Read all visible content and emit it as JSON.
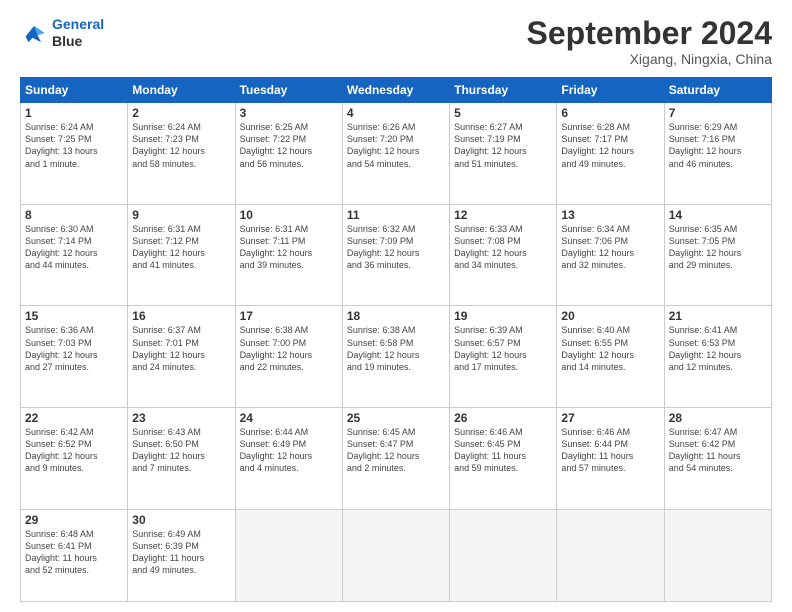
{
  "header": {
    "logo_line1": "General",
    "logo_line2": "Blue",
    "month": "September 2024",
    "location": "Xigang, Ningxia, China"
  },
  "weekdays": [
    "Sunday",
    "Monday",
    "Tuesday",
    "Wednesday",
    "Thursday",
    "Friday",
    "Saturday"
  ],
  "weeks": [
    [
      {
        "day": "1",
        "info": "Sunrise: 6:24 AM\nSunset: 7:25 PM\nDaylight: 13 hours\nand 1 minute."
      },
      {
        "day": "2",
        "info": "Sunrise: 6:24 AM\nSunset: 7:23 PM\nDaylight: 12 hours\nand 58 minutes."
      },
      {
        "day": "3",
        "info": "Sunrise: 6:25 AM\nSunset: 7:22 PM\nDaylight: 12 hours\nand 56 minutes."
      },
      {
        "day": "4",
        "info": "Sunrise: 6:26 AM\nSunset: 7:20 PM\nDaylight: 12 hours\nand 54 minutes."
      },
      {
        "day": "5",
        "info": "Sunrise: 6:27 AM\nSunset: 7:19 PM\nDaylight: 12 hours\nand 51 minutes."
      },
      {
        "day": "6",
        "info": "Sunrise: 6:28 AM\nSunset: 7:17 PM\nDaylight: 12 hours\nand 49 minutes."
      },
      {
        "day": "7",
        "info": "Sunrise: 6:29 AM\nSunset: 7:16 PM\nDaylight: 12 hours\nand 46 minutes."
      }
    ],
    [
      {
        "day": "8",
        "info": "Sunrise: 6:30 AM\nSunset: 7:14 PM\nDaylight: 12 hours\nand 44 minutes."
      },
      {
        "day": "9",
        "info": "Sunrise: 6:31 AM\nSunset: 7:12 PM\nDaylight: 12 hours\nand 41 minutes."
      },
      {
        "day": "10",
        "info": "Sunrise: 6:31 AM\nSunset: 7:11 PM\nDaylight: 12 hours\nand 39 minutes."
      },
      {
        "day": "11",
        "info": "Sunrise: 6:32 AM\nSunset: 7:09 PM\nDaylight: 12 hours\nand 36 minutes."
      },
      {
        "day": "12",
        "info": "Sunrise: 6:33 AM\nSunset: 7:08 PM\nDaylight: 12 hours\nand 34 minutes."
      },
      {
        "day": "13",
        "info": "Sunrise: 6:34 AM\nSunset: 7:06 PM\nDaylight: 12 hours\nand 32 minutes."
      },
      {
        "day": "14",
        "info": "Sunrise: 6:35 AM\nSunset: 7:05 PM\nDaylight: 12 hours\nand 29 minutes."
      }
    ],
    [
      {
        "day": "15",
        "info": "Sunrise: 6:36 AM\nSunset: 7:03 PM\nDaylight: 12 hours\nand 27 minutes."
      },
      {
        "day": "16",
        "info": "Sunrise: 6:37 AM\nSunset: 7:01 PM\nDaylight: 12 hours\nand 24 minutes."
      },
      {
        "day": "17",
        "info": "Sunrise: 6:38 AM\nSunset: 7:00 PM\nDaylight: 12 hours\nand 22 minutes."
      },
      {
        "day": "18",
        "info": "Sunrise: 6:38 AM\nSunset: 6:58 PM\nDaylight: 12 hours\nand 19 minutes."
      },
      {
        "day": "19",
        "info": "Sunrise: 6:39 AM\nSunset: 6:57 PM\nDaylight: 12 hours\nand 17 minutes."
      },
      {
        "day": "20",
        "info": "Sunrise: 6:40 AM\nSunset: 6:55 PM\nDaylight: 12 hours\nand 14 minutes."
      },
      {
        "day": "21",
        "info": "Sunrise: 6:41 AM\nSunset: 6:53 PM\nDaylight: 12 hours\nand 12 minutes."
      }
    ],
    [
      {
        "day": "22",
        "info": "Sunrise: 6:42 AM\nSunset: 6:52 PM\nDaylight: 12 hours\nand 9 minutes."
      },
      {
        "day": "23",
        "info": "Sunrise: 6:43 AM\nSunset: 6:50 PM\nDaylight: 12 hours\nand 7 minutes."
      },
      {
        "day": "24",
        "info": "Sunrise: 6:44 AM\nSunset: 6:49 PM\nDaylight: 12 hours\nand 4 minutes."
      },
      {
        "day": "25",
        "info": "Sunrise: 6:45 AM\nSunset: 6:47 PM\nDaylight: 12 hours\nand 2 minutes."
      },
      {
        "day": "26",
        "info": "Sunrise: 6:46 AM\nSunset: 6:45 PM\nDaylight: 11 hours\nand 59 minutes."
      },
      {
        "day": "27",
        "info": "Sunrise: 6:46 AM\nSunset: 6:44 PM\nDaylight: 11 hours\nand 57 minutes."
      },
      {
        "day": "28",
        "info": "Sunrise: 6:47 AM\nSunset: 6:42 PM\nDaylight: 11 hours\nand 54 minutes."
      }
    ],
    [
      {
        "day": "29",
        "info": "Sunrise: 6:48 AM\nSunset: 6:41 PM\nDaylight: 11 hours\nand 52 minutes."
      },
      {
        "day": "30",
        "info": "Sunrise: 6:49 AM\nSunset: 6:39 PM\nDaylight: 11 hours\nand 49 minutes."
      },
      {
        "day": "",
        "info": ""
      },
      {
        "day": "",
        "info": ""
      },
      {
        "day": "",
        "info": ""
      },
      {
        "day": "",
        "info": ""
      },
      {
        "day": "",
        "info": ""
      }
    ]
  ]
}
